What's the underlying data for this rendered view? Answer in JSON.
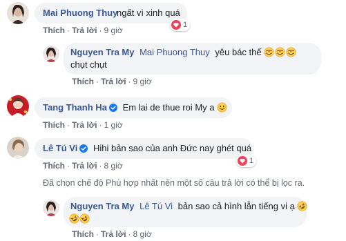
{
  "actions": {
    "like": "Thích",
    "reply": "Trả lời",
    "separator": "·"
  },
  "comments": [
    {
      "name": "Mai Phuong Thuy",
      "text": "ngất vì xinh quá",
      "time": "9 giờ",
      "reaction_count": "1"
    },
    {
      "name": "Nguyen Tra My",
      "mention": "Mai Phuong Thuy",
      "text": "yêu bác thế",
      "text_line2": "chụt chụt",
      "time": "9 giờ"
    },
    {
      "name": "Tang Thanh Ha",
      "text": "Em lai de thue roi My a",
      "time": "1 giờ"
    },
    {
      "name": "Lê Tú Vi",
      "text": "Hihi bản sao của anh Đức nay ghét quá",
      "time": "8 giờ",
      "reaction_count": "1"
    },
    {
      "name": "Nguyen Tra My",
      "mention": "Lê Tú Vi",
      "text": "bản sao cả hình lẫn tiếng vi ạ",
      "time": "8 giờ"
    }
  ],
  "filter_notice": "Đã chọn chế độ Phù hợp nhất nên một số câu trả lời có thể bị lọc ra.",
  "colors": {
    "link": "#385898",
    "bubble": "#f2f3f5",
    "meta": "#606770",
    "heart": "#f33e58",
    "verified": "#1877f2"
  }
}
